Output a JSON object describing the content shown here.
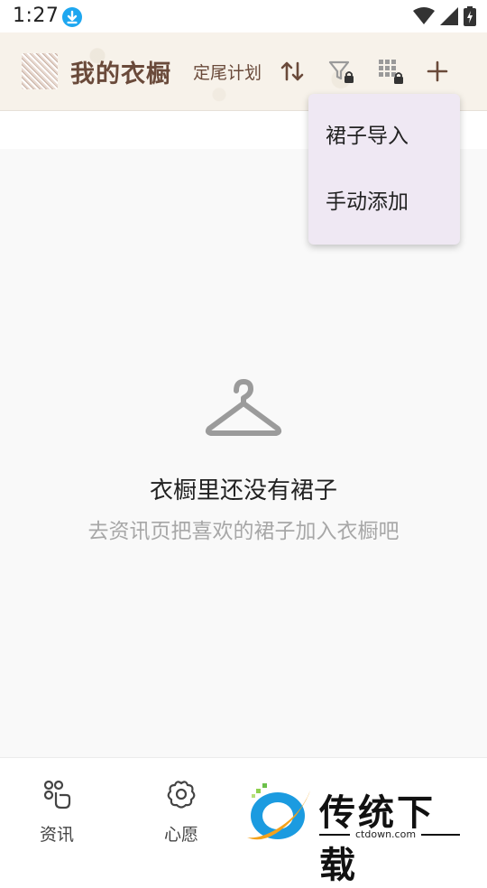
{
  "status_bar": {
    "time": "1:27",
    "icons": [
      "download-badge-icon",
      "wifi-icon",
      "signal-icon",
      "battery-charging-icon"
    ]
  },
  "app_bar": {
    "title": "我的衣橱",
    "plan_link": "定尾计划",
    "actions": [
      "sort-icon",
      "filter-locked-icon",
      "grid-locked-icon",
      "add-icon"
    ]
  },
  "menu": {
    "items": [
      "裙子导入",
      "手动添加"
    ]
  },
  "empty_state": {
    "icon": "hanger-icon",
    "title": "衣橱里还没有裙子",
    "subtitle": "去资讯页把喜欢的裙子加入衣橱吧"
  },
  "bottom_nav": {
    "items": [
      {
        "label": "资讯",
        "icon": "news-icon"
      },
      {
        "label": "心愿",
        "icon": "flower-icon"
      }
    ]
  },
  "watermark": {
    "text": "传统下载",
    "url": "ctdown.com"
  },
  "colors": {
    "title_brown": "#6a4a3a",
    "menu_bg": "#efe8f3",
    "content_bg": "#f9f9f9",
    "muted_text": "#a7a7a7"
  }
}
